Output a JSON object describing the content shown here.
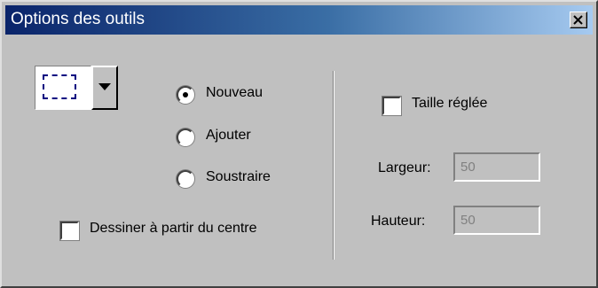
{
  "window": {
    "title": "Options des outils",
    "close_glyph": "×"
  },
  "selection_tool": {
    "icon": "rectangle-marquee-icon"
  },
  "mode": {
    "options": [
      "Nouveau",
      "Ajouter",
      "Soustraire"
    ],
    "selected": "Nouveau"
  },
  "draw_from_center": {
    "label": "Dessiner à partir du centre",
    "checked": false
  },
  "fixed_size": {
    "label": "Taille réglée",
    "checked": false
  },
  "width_field": {
    "label": "Largeur:",
    "value": "50",
    "enabled": false
  },
  "height_field": {
    "label": "Hauteur:",
    "value": "50",
    "enabled": false
  }
}
